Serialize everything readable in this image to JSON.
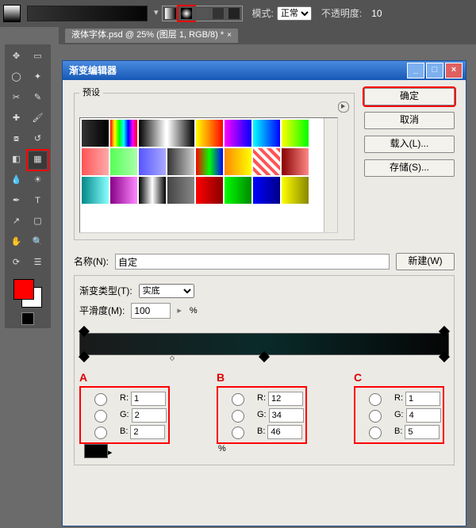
{
  "topbar": {
    "mode_label": "模式:",
    "mode_value": "正常",
    "opacity_label": "不透明度:",
    "opacity_value": "10"
  },
  "tab": {
    "title": "液体字体.psd @ 25% (图层 1, RGB/8) *",
    "close": "×"
  },
  "dialog": {
    "title": "渐变编辑器",
    "presets_label": "预设",
    "ok": "确定",
    "cancel": "取消",
    "load": "载入(L)...",
    "save": "存储(S)...",
    "name_label": "名称(N):",
    "name_value": "自定",
    "new_btn": "新建(W)",
    "type_label": "渐变类型(T):",
    "type_value": "实底",
    "smooth_label": "平滑度(M):",
    "smooth_value": "100",
    "pct": "%"
  },
  "stops": {
    "A": {
      "tag": "A",
      "R": "1",
      "G": "2",
      "B": "2"
    },
    "B": {
      "tag": "B",
      "R": "12",
      "G": "34",
      "B": "46"
    },
    "C": {
      "tag": "C",
      "R": "1",
      "G": "4",
      "B": "5"
    }
  },
  "labels": {
    "R": "R:",
    "G": "G:",
    "B": "B:"
  },
  "preset_gradients": [
    "linear-gradient(90deg,#333,#000)",
    "linear-gradient(90deg,#f00,#ff0,#0f0,#0ff,#00f,#f0f,#f00)",
    "linear-gradient(90deg,#000,#fff)",
    "linear-gradient(90deg,#fff,#000)",
    "linear-gradient(90deg,#ff0,#f80,#f00)",
    "linear-gradient(90deg,#f0f,#00f)",
    "linear-gradient(90deg,#0ff,#00f)",
    "linear-gradient(90deg,#ff0,#0f0)",
    "linear-gradient(90deg,#f55,#faa)",
    "linear-gradient(90deg,#5f5,#afa)",
    "linear-gradient(90deg,#55f,#aaf)",
    "linear-gradient(90deg,#333,#ccc)",
    "linear-gradient(90deg,#f00,#0f0,#00f)",
    "linear-gradient(90deg,#f80,#ff0)",
    "repeating-linear-gradient(45deg,#fff 0 4px,#f55 4px 8px)",
    "linear-gradient(90deg,#800,#f88)",
    "linear-gradient(90deg,#088,#8ff)",
    "linear-gradient(90deg,#808,#f8f)",
    "linear-gradient(90deg,#000,#fff,#000)",
    "linear-gradient(90deg,#444,#888)",
    "linear-gradient(90deg,#f00,#800)",
    "linear-gradient(90deg,#0f0,#080)",
    "linear-gradient(90deg,#00f,#008)",
    "linear-gradient(90deg,#ff0,#880)"
  ],
  "win": {
    "min": "_",
    "max": "□",
    "close": "×"
  }
}
